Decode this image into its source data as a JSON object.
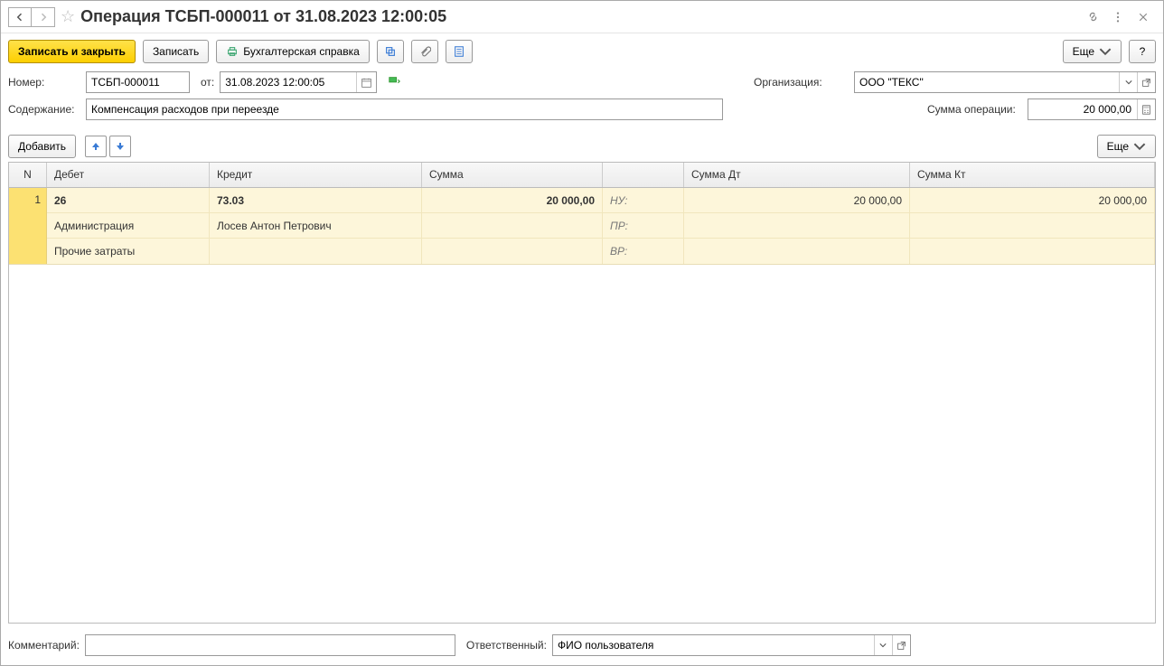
{
  "header": {
    "title": "Операция ТСБП-000011 от 31.08.2023 12:00:05"
  },
  "toolbar": {
    "save_close": "Записать и закрыть",
    "save": "Записать",
    "acct_report": "Бухгалтерская справка",
    "more": "Еще",
    "help": "?"
  },
  "form": {
    "number_label": "Номер:",
    "number_value": "ТСБП-000011",
    "from_label": "от:",
    "date_value": "31.08.2023 12:00:05",
    "org_label": "Организация:",
    "org_value": "ООО \"ТЕКС\"",
    "content_label": "Содержание:",
    "content_value": "Компенсация расходов при переезде",
    "sum_label": "Сумма операции:",
    "sum_value": "20 000,00"
  },
  "table_toolbar": {
    "add": "Добавить",
    "more": "Еще"
  },
  "table": {
    "headers": {
      "n": "N",
      "debit": "Дебет",
      "credit": "Кредит",
      "sum": "Сумма",
      "tag": "",
      "sumdt": "Сумма Дт",
      "sumkt": "Сумма Кт"
    },
    "rows": [
      {
        "n": "1",
        "lines": [
          {
            "debit": "26",
            "debit_bold": true,
            "credit": "73.03",
            "credit_bold": true,
            "sum": "20 000,00",
            "sum_bold": true,
            "tag": "НУ:",
            "sumdt": "20 000,00",
            "sumkt": "20 000,00"
          },
          {
            "debit": "Администрация",
            "credit": "Лосев Антон Петрович",
            "sum": "",
            "tag": "ПР:",
            "sumdt": "",
            "sumkt": ""
          },
          {
            "debit": "Прочие затраты",
            "credit": "",
            "sum": "",
            "tag": "ВР:",
            "sumdt": "",
            "sumkt": ""
          }
        ]
      }
    ]
  },
  "footer": {
    "comment_label": "Комментарий:",
    "comment_value": "",
    "responsible_label": "Ответственный:",
    "responsible_value": "ФИО пользователя"
  }
}
